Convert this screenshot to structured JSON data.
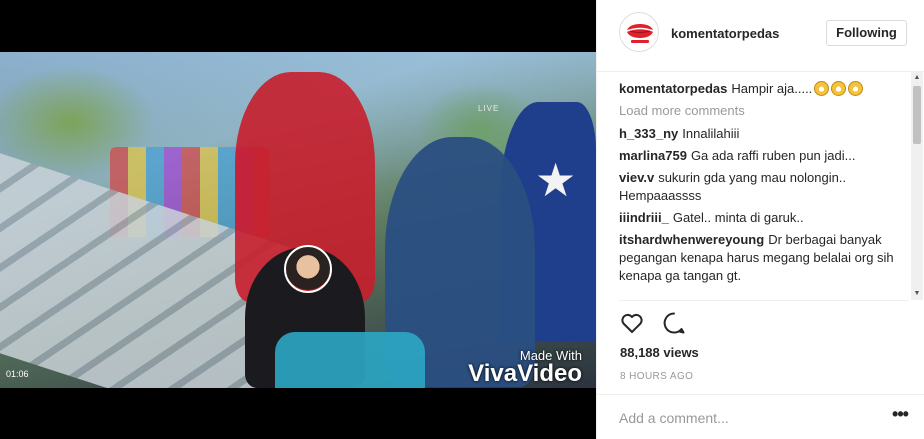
{
  "video": {
    "timestamp": "01:06",
    "watermark_small": "Made With",
    "watermark_big": "VivaVideo",
    "overlay_text": "LIVE"
  },
  "header": {
    "username": "komentatorpedas",
    "follow_label": "Following",
    "profile_icon": "lips-logo-icon"
  },
  "caption": {
    "username": "komentatorpedas",
    "text": "Hampir aja....."
  },
  "load_more_label": "Load more comments",
  "comments": [
    {
      "user": "h_333_ny",
      "text": "Innalilahiii"
    },
    {
      "user": "marlina759",
      "text": "Ga ada raffi ruben pun jadi..."
    },
    {
      "user": "viev.v",
      "text": "sukurin gda yang mau nolongin.. Hempaaassss"
    },
    {
      "user": "iiindriii_",
      "text": "Gatel.. minta di garuk.."
    },
    {
      "user": "itshardwhenwereyoung",
      "text": "Dr berbagai banyak pegangan kenapa harus megang belalai org sih kenapa ga tangan gt."
    }
  ],
  "stats": {
    "views": "88,188 views",
    "time_ago": "8 HOURS AGO"
  },
  "comment_box": {
    "placeholder": "Add a comment...",
    "more_label": "•••"
  },
  "colors": {
    "text": "#262626",
    "muted": "#999999",
    "border": "#efefef",
    "accent_red": "#e0202a"
  }
}
